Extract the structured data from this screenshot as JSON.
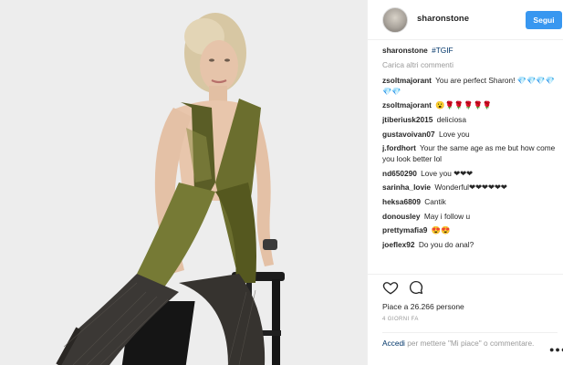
{
  "post": {
    "author": "sharonstone",
    "follow_label": "Segui"
  },
  "caption": {
    "user": "sharonstone",
    "hashtag": "#TGIF"
  },
  "load_more_label": "Carica altri commenti",
  "comments": [
    {
      "user": "zsoltmajorant",
      "text": "You are perfect Sharon! 💎💎💎💎💎💎"
    },
    {
      "user": "zsoltmajorant",
      "text": "😮🌹🌹🌹🌹🌹"
    },
    {
      "user": "jtiberiusk2015",
      "text": "deliciosa"
    },
    {
      "user": "gustavoivan07",
      "text": "Love you"
    },
    {
      "user": "j.fordhort",
      "text": "Your the same age as me but how come you look better lol"
    },
    {
      "user": "nd650290",
      "text": "Love you ❤❤❤"
    },
    {
      "user": "sarinha_lovie",
      "text": "Wonderful❤❤❤❤❤❤"
    },
    {
      "user": "heksa6809",
      "text": "Cantik"
    },
    {
      "user": "donousley",
      "text": "May i follow u"
    },
    {
      "user": "prettymafia9",
      "text": "😍😍"
    },
    {
      "user": "joeflex92",
      "text": "Do you do anal?"
    }
  ],
  "likes_text": "Piace a 26.266 persone",
  "time_ago": "4 GIORNI FA",
  "login": {
    "link": "Accedi",
    "rest": " per mettere \"Mi piace\" o commentare."
  },
  "icons": {
    "like": "heart-icon",
    "comment": "comment-icon",
    "more": "more-options-icon"
  },
  "colors": {
    "follow_button": "#3897f0",
    "link": "#003569",
    "muted": "#999999"
  }
}
